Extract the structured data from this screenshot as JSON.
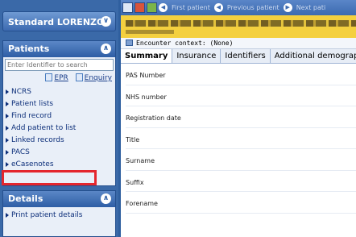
{
  "nav": {
    "patient_header": "Standard LORENZO",
    "patients_section": {
      "title": "Patients",
      "search_placeholder": "Enter Identifier to search",
      "links": [
        "EPR",
        "Enquiry"
      ],
      "menu": [
        "NCRS",
        "Patient lists",
        "Find record",
        "Add patient to list",
        "Linked records",
        "PACS",
        "eCasenotes"
      ]
    },
    "details_section": {
      "title": "Details",
      "menu": [
        "Print patient details"
      ]
    }
  },
  "toolbar": {
    "first_patient": "First patient",
    "previous_patient": "Previous patient",
    "next_patient": "Next pati"
  },
  "context": {
    "label": "Encounter context: (None)"
  },
  "tabs": [
    "Summary",
    "Insurance",
    "Identifiers",
    "Additional demograp"
  ],
  "fields": [
    "PAS Number",
    "NHS number",
    "Registration date",
    "Title",
    "Surname",
    "Suffix",
    "Forename"
  ]
}
